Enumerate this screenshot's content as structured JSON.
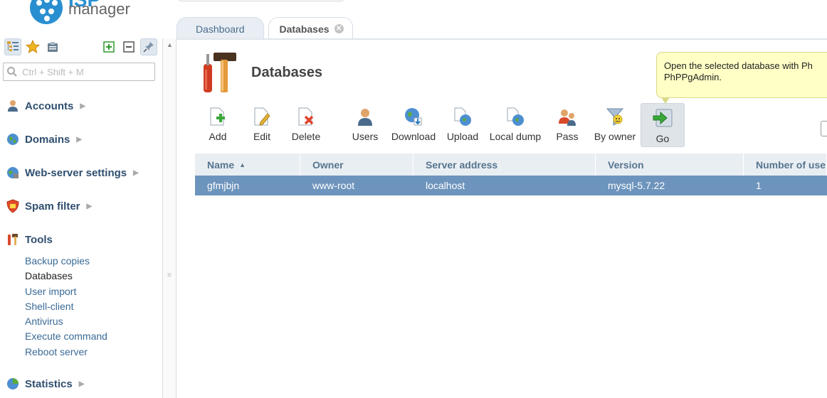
{
  "app": {
    "logo_top": "ISP",
    "logo_bottom": "manager"
  },
  "sidebar": {
    "search_placeholder": "Ctrl + Shift + M",
    "sections": [
      {
        "label": "Accounts",
        "icon": "accounts-icon"
      },
      {
        "label": "Domains",
        "icon": "domains-icon"
      },
      {
        "label": "Web-server settings",
        "icon": "web-server-icon"
      },
      {
        "label": "Spam filter",
        "icon": "spam-filter-icon"
      },
      {
        "label": "Tools",
        "icon": "tools-icon"
      },
      {
        "label": "Statistics",
        "icon": "statistics-icon"
      }
    ],
    "tools_items": [
      "Backup copies",
      "Databases",
      "User import",
      "Shell-client",
      "Antivirus",
      "Execute command",
      "Reboot server"
    ]
  },
  "tabs": [
    {
      "label": "Dashboard",
      "active": false
    },
    {
      "label": "Databases",
      "active": true
    }
  ],
  "page": {
    "title": "Databases"
  },
  "tooltip": {
    "text_line1": "Open the selected database with Ph",
    "text_line2": "PhPPgAdmin."
  },
  "toolbar": [
    {
      "label": "Add",
      "icon": "add-database-icon"
    },
    {
      "label": "Edit",
      "icon": "edit-database-icon"
    },
    {
      "label": "Delete",
      "icon": "delete-database-icon"
    },
    {
      "label": "Users",
      "icon": "users-icon"
    },
    {
      "label": "Download",
      "icon": "download-icon"
    },
    {
      "label": "Upload",
      "icon": "upload-icon"
    },
    {
      "label": "Local dump",
      "icon": "local-dump-icon"
    },
    {
      "label": "Pass",
      "icon": "pass-icon"
    },
    {
      "label": "By owner",
      "icon": "filter-by-owner-icon"
    },
    {
      "label": "Go",
      "icon": "go-arrow-icon"
    }
  ],
  "table": {
    "columns": [
      "Name",
      "Owner",
      "Server address",
      "Version",
      "Number of use"
    ],
    "sort_column": "Name",
    "rows": [
      [
        "gfmjbjn",
        "www-root",
        "localhost",
        "mysql-5.7.22",
        "1"
      ]
    ]
  },
  "colors": {
    "selected_row": "#6d94bc",
    "header_bg": "#e9eef3",
    "link": "#3a6a96",
    "tooltip_bg": "#ffffc6"
  }
}
